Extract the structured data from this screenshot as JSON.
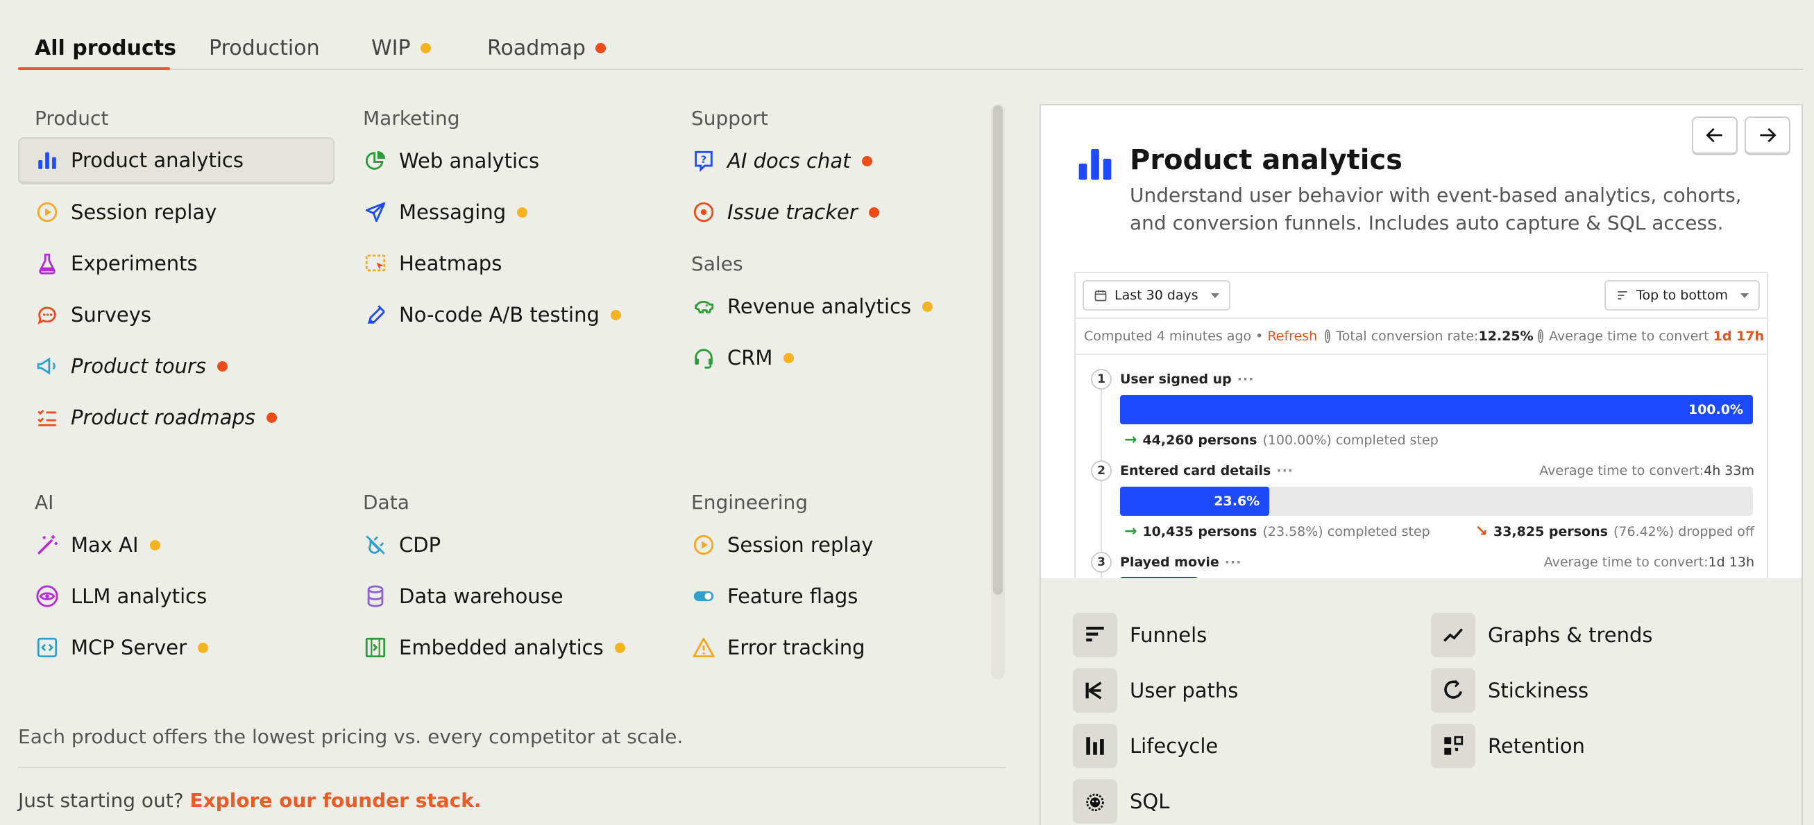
{
  "tabs": [
    {
      "label": "All products",
      "active": true
    },
    {
      "label": "Production"
    },
    {
      "label": "WIP",
      "dot": "yellow"
    },
    {
      "label": "Roadmap",
      "dot": "red"
    }
  ],
  "categories": {
    "product": "Product",
    "marketing": "Marketing",
    "support": "Support",
    "sales": "Sales",
    "ai": "AI",
    "data": "Data",
    "engineering": "Engineering"
  },
  "items": {
    "product_analytics": "Product analytics",
    "session_replay": "Session replay",
    "experiments": "Experiments",
    "surveys": "Surveys",
    "product_tours": "Product tours",
    "product_roadmaps": "Product roadmaps",
    "web_analytics": "Web analytics",
    "messaging": "Messaging",
    "heatmaps": "Heatmaps",
    "ab_testing": "No-code A/B testing",
    "ai_docs_chat": "AI docs chat",
    "issue_tracker": "Issue tracker",
    "revenue_analytics": "Revenue analytics",
    "crm": "CRM",
    "max_ai": "Max AI",
    "llm_analytics": "LLM analytics",
    "mcp_server": "MCP Server",
    "cdp": "CDP",
    "data_warehouse": "Data warehouse",
    "embedded_analytics": "Embedded analytics",
    "eng_session_replay": "Session replay",
    "feature_flags": "Feature flags",
    "error_tracking": "Error tracking"
  },
  "footer": {
    "note": "Each product offers the lowest pricing vs. every competitor at scale.",
    "cta_prefix": "Just starting out?",
    "cta_link": "Explore our founder stack."
  },
  "preview": {
    "title": "Product analytics",
    "description": "Understand user behavior with event-based analytics, cohorts, and conversion funnels. Includes auto capture & SQL access.",
    "date_range": "Last 30 days",
    "order": "Top to bottom",
    "computed": "Computed 4 minutes ago •",
    "refresh": "Refresh",
    "total_conv_label": "Total conversion rate:",
    "total_conv_value": "12.25%",
    "avg_time_label": "Average time to convert",
    "avg_time_value": "1d 17h",
    "steps": [
      {
        "num": "1",
        "name": "User signed up",
        "pct": "100.0%",
        "fill": 1.0,
        "persons": "44,260 persons",
        "persons_pct": "(100.00%) completed step"
      },
      {
        "num": "2",
        "name": "Entered card details",
        "pct": "23.6%",
        "fill": 0.236,
        "avg_label": "Average time to convert:",
        "avg_value": "4h 33m",
        "persons": "10,435 persons",
        "persons_pct": "(23.58%) completed step",
        "dropped": "33,825 persons",
        "dropped_pct": "(76.42%) dropped off"
      },
      {
        "num": "3",
        "name": "Played movie",
        "avg_label": "Average time to convert:",
        "avg_value": "1d 13h"
      }
    ],
    "more": "···"
  },
  "features": {
    "funnels": "Funnels",
    "graphs": "Graphs & trends",
    "user_paths": "User paths",
    "stickiness": "Stickiness",
    "lifecycle": "Lifecycle",
    "retention": "Retention",
    "sql": "SQL"
  },
  "colors": {
    "accent": "#ea5b25",
    "dot_yellow": "#f5b31f",
    "dot_red": "#ee4b1b",
    "funnel_blue": "#1d4aff"
  }
}
